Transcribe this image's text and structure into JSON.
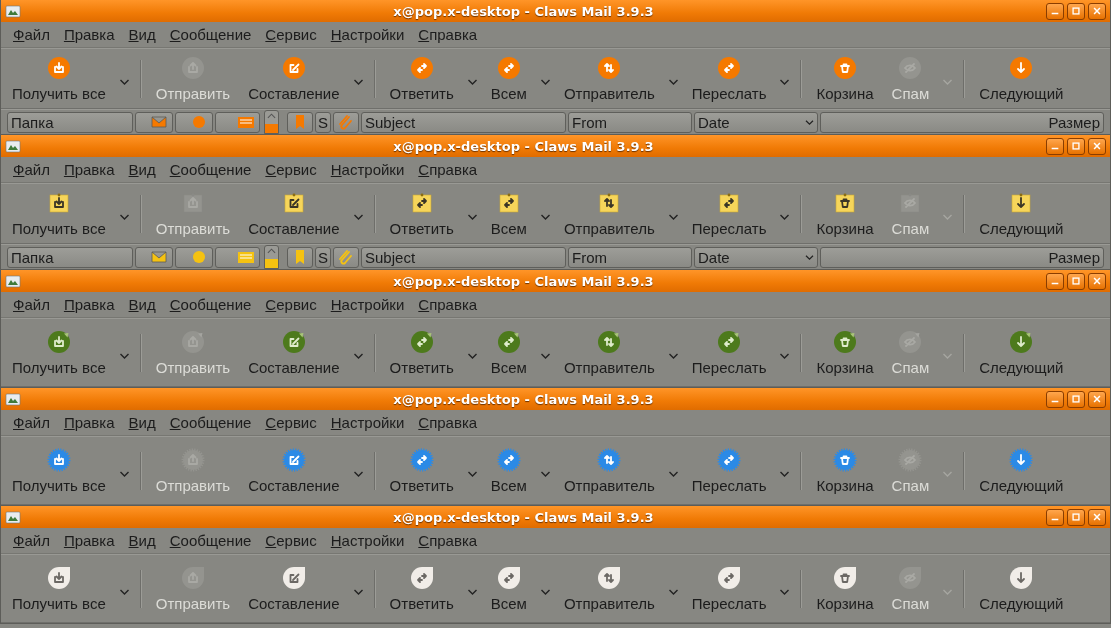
{
  "windows": [
    {
      "title": "x@pop.x-desktop - Claws Mail 3.9.3",
      "kind": "orange-circle",
      "menu": [
        "Файл",
        "Правка",
        "Вид",
        "Сообщение",
        "Сервис",
        "Настройки",
        "Справка"
      ],
      "toolbar": [
        {
          "kind": "button",
          "label": "Получить все",
          "disabled": false,
          "dropdown": true
        },
        {
          "kind": "separator"
        },
        {
          "kind": "button",
          "label": "Отправить",
          "disabled": true,
          "dropdown": false
        },
        {
          "kind": "button",
          "label": "Составление",
          "disabled": false,
          "dropdown": true
        },
        {
          "kind": "separator"
        },
        {
          "kind": "button",
          "label": "Ответить",
          "disabled": false,
          "dropdown": true
        },
        {
          "kind": "button",
          "label": "Всем",
          "disabled": false,
          "dropdown": true
        },
        {
          "kind": "button",
          "label": "Отправитель",
          "disabled": false,
          "dropdown": true
        },
        {
          "kind": "button",
          "label": "Переслать",
          "disabled": false,
          "dropdown": true
        },
        {
          "kind": "separator"
        },
        {
          "kind": "button",
          "label": "Корзина",
          "disabled": false,
          "dropdown": false
        },
        {
          "kind": "button",
          "label": "Спам",
          "disabled": true,
          "dropdown": true
        },
        {
          "kind": "separator"
        },
        {
          "kind": "button",
          "label": "Следующий",
          "disabled": false,
          "dropdown": false
        }
      ],
      "folder_columns": [
        {
          "kind": "label",
          "label": "Папка"
        },
        {
          "kind": "icon"
        },
        {
          "kind": "icon"
        },
        {
          "kind": "icon"
        }
      ],
      "message_columns": [
        {
          "kind": "icon"
        },
        {
          "kind": "label",
          "label": "S",
          "sorted": false
        },
        {
          "kind": "icon"
        },
        {
          "kind": "label",
          "label": "Subject",
          "sorted": false
        },
        {
          "kind": "label",
          "label": "From",
          "sorted": false
        },
        {
          "kind": "label",
          "label": "Date",
          "sorted": true
        },
        {
          "kind": "number",
          "label": "Размер",
          "sorted": false
        }
      ]
    },
    {
      "title": "x@pop.x-desktop - Claws Mail 3.9.3",
      "kind": "sticky-note",
      "menu": [
        "Файл",
        "Правка",
        "Вид",
        "Сообщение",
        "Сервис",
        "Настройки",
        "Справка"
      ],
      "toolbar": [
        {
          "kind": "button",
          "label": "Получить все",
          "disabled": false,
          "dropdown": true
        },
        {
          "kind": "separator"
        },
        {
          "kind": "button",
          "label": "Отправить",
          "disabled": true,
          "dropdown": false
        },
        {
          "kind": "button",
          "label": "Составление",
          "disabled": false,
          "dropdown": true
        },
        {
          "kind": "separator"
        },
        {
          "kind": "button",
          "label": "Ответить",
          "disabled": false,
          "dropdown": true
        },
        {
          "kind": "button",
          "label": "Всем",
          "disabled": false,
          "dropdown": true
        },
        {
          "kind": "button",
          "label": "Отправитель",
          "disabled": false,
          "dropdown": true
        },
        {
          "kind": "button",
          "label": "Переслать",
          "disabled": false,
          "dropdown": true
        },
        {
          "kind": "separator"
        },
        {
          "kind": "button",
          "label": "Корзина",
          "disabled": false,
          "dropdown": false
        },
        {
          "kind": "button",
          "label": "Спам",
          "disabled": true,
          "dropdown": true
        },
        {
          "kind": "separator"
        },
        {
          "kind": "button",
          "label": "Следующий",
          "disabled": false,
          "dropdown": false
        }
      ],
      "folder_columns": [
        {
          "kind": "label",
          "label": "Папка"
        },
        {
          "kind": "icon"
        },
        {
          "kind": "icon"
        },
        {
          "kind": "icon"
        }
      ],
      "message_columns": [
        {
          "kind": "icon"
        },
        {
          "kind": "label",
          "label": "S",
          "sorted": false
        },
        {
          "kind": "icon"
        },
        {
          "kind": "label",
          "label": "Subject",
          "sorted": false
        },
        {
          "kind": "label",
          "label": "From",
          "sorted": false
        },
        {
          "kind": "label",
          "label": "Date",
          "sorted": true
        },
        {
          "kind": "number",
          "label": "Размер",
          "sorted": false
        }
      ]
    },
    {
      "title": "x@pop.x-desktop - Claws Mail 3.9.3",
      "kind": "green-sticker",
      "menu": [
        "Файл",
        "Правка",
        "Вид",
        "Сообщение",
        "Сервис",
        "Настройки",
        "Справка"
      ],
      "toolbar": [
        {
          "kind": "button",
          "label": "Получить все",
          "disabled": false,
          "dropdown": true
        },
        {
          "kind": "separator"
        },
        {
          "kind": "button",
          "label": "Отправить",
          "disabled": true,
          "dropdown": false
        },
        {
          "kind": "button",
          "label": "Составление",
          "disabled": false,
          "dropdown": true
        },
        {
          "kind": "separator"
        },
        {
          "kind": "button",
          "label": "Ответить",
          "disabled": false,
          "dropdown": true
        },
        {
          "kind": "button",
          "label": "Всем",
          "disabled": false,
          "dropdown": true
        },
        {
          "kind": "button",
          "label": "Отправитель",
          "disabled": false,
          "dropdown": true
        },
        {
          "kind": "button",
          "label": "Переслать",
          "disabled": false,
          "dropdown": true
        },
        {
          "kind": "separator"
        },
        {
          "kind": "button",
          "label": "Корзина",
          "disabled": false,
          "dropdown": false
        },
        {
          "kind": "button",
          "label": "Спам",
          "disabled": true,
          "dropdown": true
        },
        {
          "kind": "separator"
        },
        {
          "kind": "button",
          "label": "Следующий",
          "disabled": false,
          "dropdown": false
        }
      ]
    },
    {
      "title": "x@pop.x-desktop - Claws Mail 3.9.3",
      "kind": "blue-badge",
      "menu": [
        "Файл",
        "Правка",
        "Вид",
        "Сообщение",
        "Сервис",
        "Настройки",
        "Справка"
      ],
      "toolbar": [
        {
          "kind": "button",
          "label": "Получить все",
          "disabled": false,
          "dropdown": true
        },
        {
          "kind": "separator"
        },
        {
          "kind": "button",
          "label": "Отправить",
          "disabled": true,
          "dropdown": false
        },
        {
          "kind": "button",
          "label": "Составление",
          "disabled": false,
          "dropdown": true
        },
        {
          "kind": "separator"
        },
        {
          "kind": "button",
          "label": "Ответить",
          "disabled": false,
          "dropdown": true
        },
        {
          "kind": "button",
          "label": "Всем",
          "disabled": false,
          "dropdown": true
        },
        {
          "kind": "button",
          "label": "Отправитель",
          "disabled": false,
          "dropdown": true
        },
        {
          "kind": "button",
          "label": "Переслать",
          "disabled": false,
          "dropdown": true
        },
        {
          "kind": "separator"
        },
        {
          "kind": "button",
          "label": "Корзина",
          "disabled": false,
          "dropdown": false
        },
        {
          "kind": "button",
          "label": "Спам",
          "disabled": true,
          "dropdown": true
        },
        {
          "kind": "separator"
        },
        {
          "kind": "button",
          "label": "Следующий",
          "disabled": false,
          "dropdown": false
        }
      ]
    },
    {
      "title": "x@pop.x-desktop - Claws Mail 3.9.3",
      "kind": "white-drop",
      "menu": [
        "Файл",
        "Правка",
        "Вид",
        "Сообщение",
        "Сервис",
        "Настройки",
        "Справка"
      ],
      "toolbar": [
        {
          "kind": "button",
          "label": "Получить все",
          "disabled": false,
          "dropdown": true
        },
        {
          "kind": "separator"
        },
        {
          "kind": "button",
          "label": "Отправить",
          "disabled": true,
          "dropdown": false
        },
        {
          "kind": "button",
          "label": "Составление",
          "disabled": false,
          "dropdown": true
        },
        {
          "kind": "separator"
        },
        {
          "kind": "button",
          "label": "Ответить",
          "disabled": false,
          "dropdown": true
        },
        {
          "kind": "button",
          "label": "Всем",
          "disabled": false,
          "dropdown": true
        },
        {
          "kind": "button",
          "label": "Отправитель",
          "disabled": false,
          "dropdown": true
        },
        {
          "kind": "button",
          "label": "Переслать",
          "disabled": false,
          "dropdown": true
        },
        {
          "kind": "separator"
        },
        {
          "kind": "button",
          "label": "Корзина",
          "disabled": false,
          "dropdown": false
        },
        {
          "kind": "button",
          "label": "Спам",
          "disabled": true,
          "dropdown": true
        },
        {
          "kind": "separator"
        },
        {
          "kind": "button",
          "label": "Следующий",
          "disabled": false,
          "dropdown": false
        }
      ]
    }
  ]
}
